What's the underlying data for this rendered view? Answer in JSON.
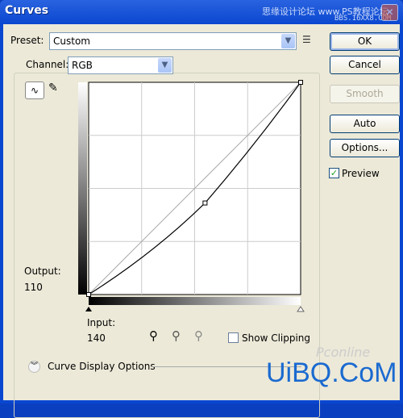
{
  "window": {
    "title": "Curves",
    "watermark_top": "思缘设计论坛 www.PS教程论坛",
    "watermark_sub": "BBS.16XX8.COM",
    "watermark_bottom": "UiBQ.CoM",
    "watermark_logo": "Pconline"
  },
  "preset": {
    "label": "Preset:",
    "value": "Custom"
  },
  "channel": {
    "label": "Channel:",
    "value": "RGB"
  },
  "buttons": {
    "ok": "OK",
    "cancel": "Cancel",
    "smooth": "Smooth",
    "auto": "Auto",
    "options": "Options..."
  },
  "preview": {
    "label": "Preview",
    "checked": true
  },
  "output": {
    "label": "Output:",
    "value": "110"
  },
  "input": {
    "label": "Input:",
    "value": "140"
  },
  "show_clipping": {
    "label": "Show Clipping",
    "checked": false
  },
  "curve_display_options": "Curve Display Options",
  "curve": {
    "points": [
      [
        0,
        0
      ],
      [
        140,
        110
      ],
      [
        255,
        255
      ]
    ]
  }
}
